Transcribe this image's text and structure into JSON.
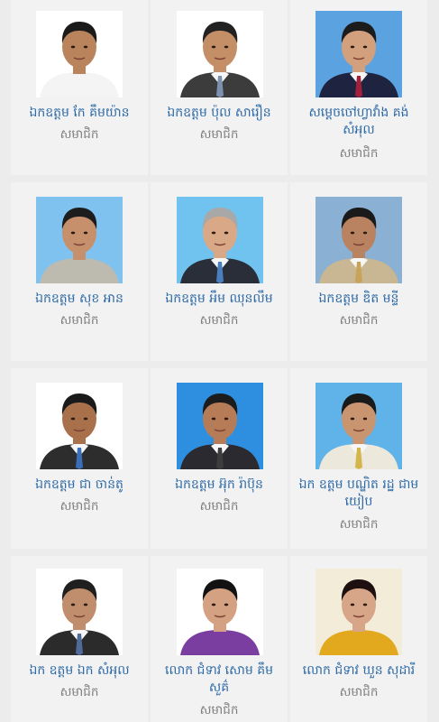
{
  "members": [
    {
      "name": "ឯកឧត្តម កែ គឹមយ៉ាន",
      "role": "សមាជិក",
      "photo_bg": "#ffffff",
      "skin": "#b9835c",
      "hair": "#1a1a1a",
      "attire": "#f4f4f4",
      "tie": ""
    },
    {
      "name": "ឯកឧត្តម ប៉ុល សារឿន",
      "role": "សមាជិក",
      "photo_bg": "#ffffff",
      "skin": "#c48e66",
      "hair": "#222222",
      "attire": "#3c3c3c",
      "tie": "#7d90b0"
    },
    {
      "name": "សម្តេចចៅហ្វាវាំង គង់ សំអុល",
      "role": "សមាជិក",
      "photo_bg": "#5aa2e0",
      "skin": "#d3a07d",
      "hair": "#1c1c1c",
      "attire": "#1e2440",
      "tie": "#a3203a"
    },
    {
      "name": "ឯកឧត្តម សុខ អាន",
      "role": "សមាជិក",
      "photo_bg": "#7fc2ef",
      "skin": "#c5906b",
      "hair": "#1d1d1d",
      "attire": "#bdbab0",
      "tie": ""
    },
    {
      "name": "ឯកឧត្តម អឹម ឈុនលឹម",
      "role": "សមាជិក",
      "photo_bg": "#6fc3ee",
      "skin": "#d9a887",
      "hair": "#a8a8a8",
      "attire": "#2a2e38",
      "tie": "#4a7fbf"
    },
    {
      "name": "ឯកឧត្តម ឌិត មន្ទី",
      "role": "សមាជិក",
      "photo_bg": "#8ab0d4",
      "skin": "#b98361",
      "hair": "#1a1a1a",
      "attire": "#c9b692",
      "tie": "#c8a35a"
    },
    {
      "name": "ឯកឧត្តម ជា ចាន់តូ",
      "role": "សមាជិក",
      "photo_bg": "#ffffff",
      "skin": "#a8714c",
      "hair": "#1a1a1a",
      "attire": "#2d2d2d",
      "tie": "#3a6fb8"
    },
    {
      "name": "ឯកឧត្តម អ៊ុក រ៉ាប៊ុន",
      "role": "សមាជិក",
      "photo_bg": "#2e8fe0",
      "skin": "#b57c57",
      "hair": "#1c1c1c",
      "attire": "#2a2a30",
      "tie": "#3c3c3c"
    },
    {
      "name": "ឯក ឧត្តម បណ្ឌិត រដ្ឋ ជាម យៀប",
      "role": "សមាជិក",
      "photo_bg": "#5fb3e8",
      "skin": "#c99470",
      "hair": "#1a1a1a",
      "attire": "#ece8dc",
      "tie": "#d4b54a"
    },
    {
      "name": "ឯក ឧត្តម ឯក សំអុល",
      "role": "សមាជិក",
      "photo_bg": "#ffffff",
      "skin": "#c08e6c",
      "hair": "#1f1f1f",
      "attire": "#2b2b2b",
      "tie": "#4f6b9a"
    },
    {
      "name": "លោក ជំទាវ សោម គឹម សួគ៌",
      "role": "សមាជិក",
      "photo_bg": "#ffffff",
      "skin": "#d4a283",
      "hair": "#121212",
      "attire": "#7a3ea0",
      "tie": ""
    },
    {
      "name": "លោក ជំទាវ ឃួន សុដារី",
      "role": "សមាជិក",
      "photo_bg": "#f3ecd8",
      "skin": "#d7a688",
      "hair": "#1e1010",
      "attire": "#e2a81e",
      "tie": ""
    }
  ]
}
